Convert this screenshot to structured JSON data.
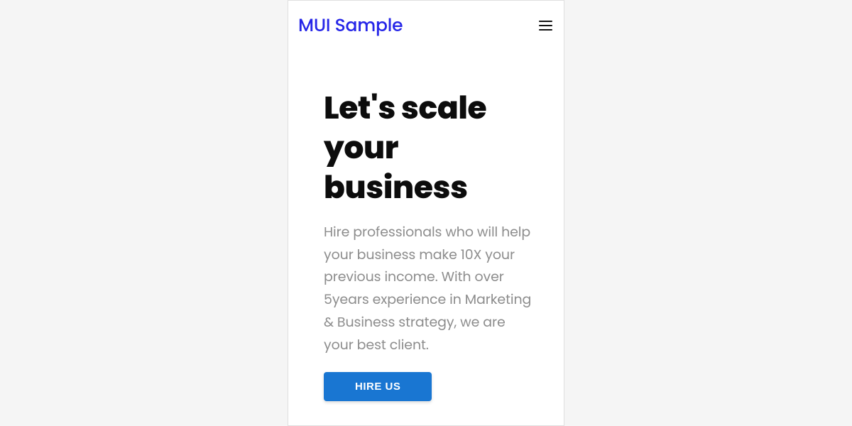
{
  "header": {
    "logo": "MUI Sample"
  },
  "hero": {
    "title": "Let's scale your business",
    "subtitle": "Hire professionals who will help your business make 10X your previous income. With over 5years experience in Marketing & Business strategy, we are your best client.",
    "cta_label": "HIRE US"
  }
}
